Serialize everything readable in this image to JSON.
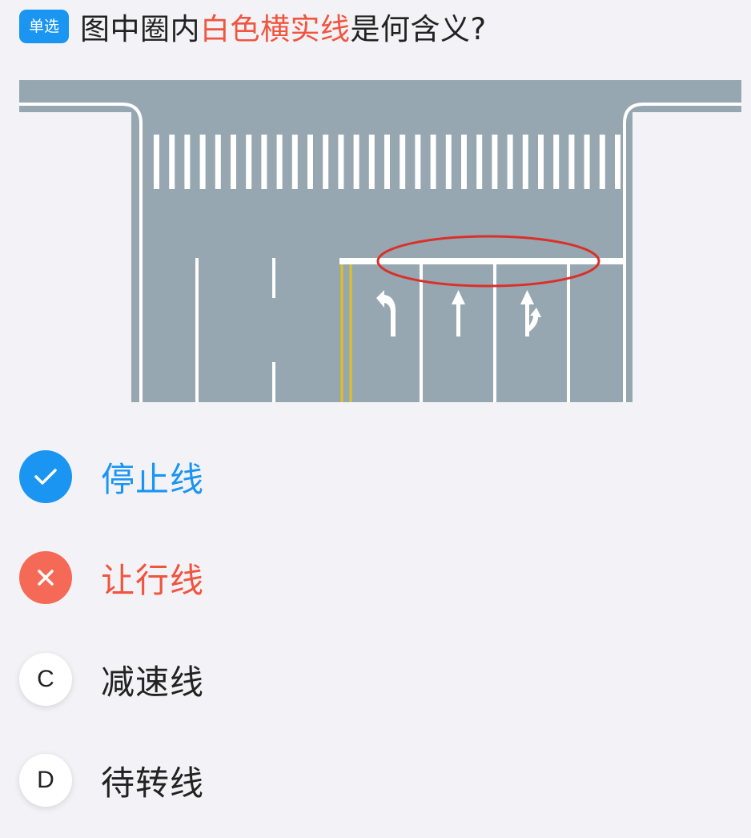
{
  "question": {
    "badge": "单选",
    "text_before": "图中圈内",
    "text_highlight": "白色横实线",
    "text_after": "是何含义?"
  },
  "figure": {
    "illustration": "road-intersection-stop-line",
    "colors": {
      "road": "#97a7b1",
      "marking": "#ffffff",
      "yellow_line": "#e0c21e",
      "circle": "#d9302a"
    }
  },
  "options": [
    {
      "icon": "check-icon",
      "label": "停止线",
      "state": "correct"
    },
    {
      "icon": "cross-icon",
      "label": "让行线",
      "state": "wrong"
    },
    {
      "letter": "C",
      "label": "减速线",
      "state": "default"
    },
    {
      "letter": "D",
      "label": "待转线",
      "state": "default"
    }
  ],
  "colors": {
    "accent": "#1a95f2",
    "error": "#f0553f",
    "background": "#f3f2f6"
  }
}
